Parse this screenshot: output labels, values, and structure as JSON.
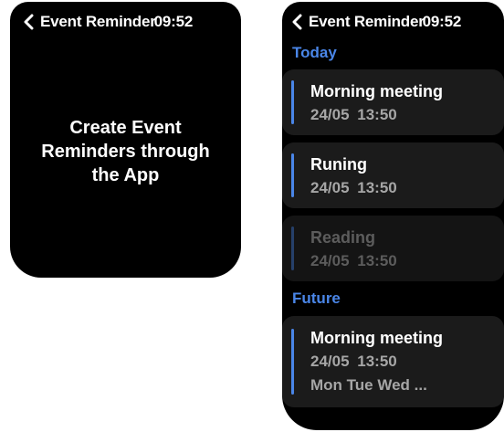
{
  "left_screen": {
    "status": {
      "title": "Event Reminder",
      "time": "09:52"
    },
    "message": "Create Event\nReminders through\nthe App"
  },
  "right_screen": {
    "status": {
      "title": "Event Reminder",
      "time": "09:52"
    },
    "sections": [
      {
        "header": "Today",
        "events": [
          {
            "name": "Morning meeting",
            "datetime": "24/05  13:50",
            "state": "active"
          },
          {
            "name": "Runing",
            "datetime": "24/05  13:50",
            "state": "active"
          },
          {
            "name": "Reading",
            "datetime": "24/05  13:50",
            "state": "past"
          }
        ]
      },
      {
        "header": "Future",
        "events": [
          {
            "name": "Morning meeting",
            "datetime": "24/05  13:50",
            "repeat": "Mon Tue Wed ...",
            "state": "active"
          }
        ]
      }
    ]
  },
  "colors": {
    "accent": "#4a86e8",
    "card": "#1b1b1b",
    "secondary_text": "#a6a6a6",
    "disabled_text": "#5c5c5c"
  },
  "icons": {
    "back": "chevron-left-icon"
  }
}
